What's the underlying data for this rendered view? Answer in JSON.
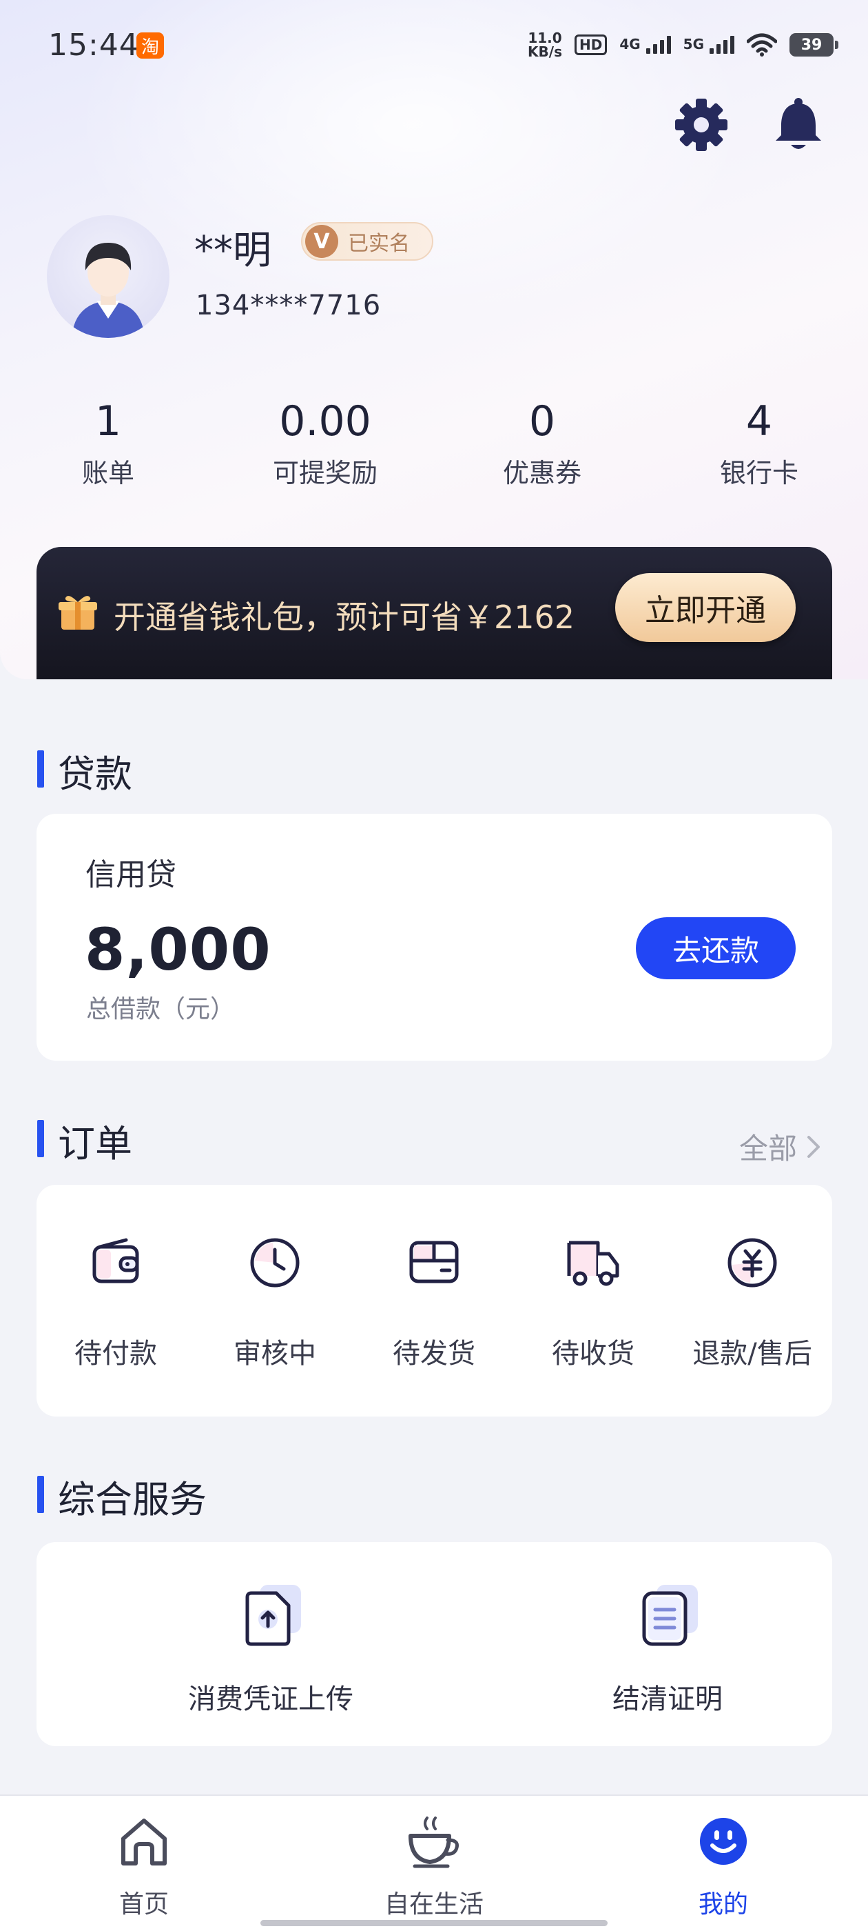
{
  "status_bar": {
    "time": "15:44",
    "taobao_badge": "淘",
    "net_speed_value": "11.0",
    "net_speed_unit": "KB/s",
    "hd": "HD",
    "net1": "4G",
    "net2": "5G",
    "battery": "39"
  },
  "profile": {
    "name": "**明",
    "verified_badge": "已实名",
    "verified_v": "V",
    "phone": "134****7716"
  },
  "stats": [
    {
      "value": "1",
      "label": "账单"
    },
    {
      "value": "0.00",
      "label": "可提奖励"
    },
    {
      "value": "0",
      "label": "优惠券"
    },
    {
      "value": "4",
      "label": "银行卡"
    }
  ],
  "promo": {
    "text": "开通省钱礼包，预计可省￥2162",
    "button": "立即开通"
  },
  "loan": {
    "section_title": "贷款",
    "label": "信用贷",
    "amount": "8,000",
    "amount_caption": "总借款（元）",
    "repay_button": "去还款"
  },
  "orders": {
    "section_title": "订单",
    "all_link": "全部",
    "items": [
      {
        "label": "待付款",
        "icon": "wallet-icon"
      },
      {
        "label": "审核中",
        "icon": "clock-icon"
      },
      {
        "label": "待发货",
        "icon": "package-icon"
      },
      {
        "label": "待收货",
        "icon": "truck-icon"
      },
      {
        "label": "退款/售后",
        "icon": "refund-icon"
      }
    ]
  },
  "services": {
    "section_title": "综合服务",
    "items": [
      {
        "label": "消费凭证上传",
        "icon": "upload-document-icon"
      },
      {
        "label": "结清证明",
        "icon": "certificate-document-icon"
      }
    ]
  },
  "bottom_nav": {
    "items": [
      {
        "label": "首页",
        "icon": "home-icon",
        "active": false
      },
      {
        "label": "自在生活",
        "icon": "coffee-cup-icon",
        "active": false
      },
      {
        "label": "我的",
        "icon": "smiley-icon",
        "active": true
      }
    ]
  },
  "colors": {
    "accent": "#2246f5",
    "section_bar": "#2752f0",
    "promo_text": "#f3dcbc"
  }
}
